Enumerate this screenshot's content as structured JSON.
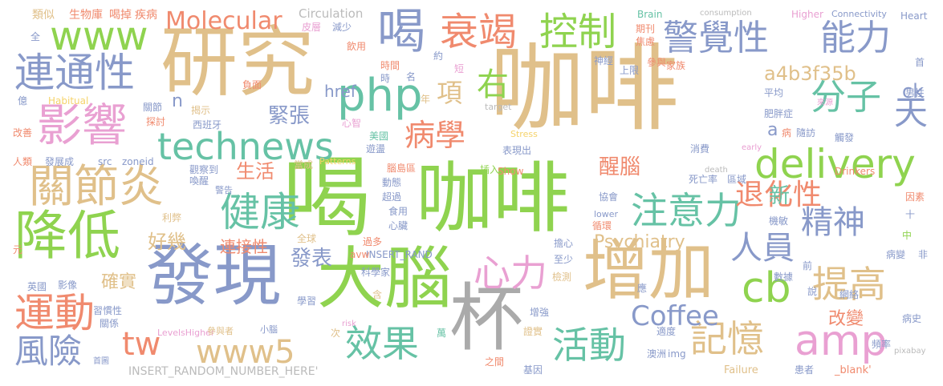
{
  "words": [
    {
      "text": "咖啡",
      "color": "#e0c08a"
    },
    {
      "text": "喝",
      "color": "#8fd34f"
    },
    {
      "text": "咖啡",
      "color": "#8fd34f"
    },
    {
      "text": "研究",
      "color": "#e0c08a"
    },
    {
      "text": "杯",
      "color": "#aaaaaa"
    },
    {
      "text": "發現",
      "color": "#8899c9"
    },
    {
      "text": "大腦",
      "color": "#8fd34f"
    },
    {
      "text": "增加",
      "color": "#e0c08a"
    },
    {
      "text": "降低",
      "color": "#8fd34f"
    },
    {
      "text": "影響",
      "color": "#e9a0d2"
    },
    {
      "text": "關節炎",
      "color": "#e0c08a"
    },
    {
      "text": "連通性",
      "color": "#8899c9"
    },
    {
      "text": "運動",
      "color": "#f08a6e"
    },
    {
      "text": "風險",
      "color": "#8899c9"
    },
    {
      "text": "喝",
      "color": "#8899c9"
    },
    {
      "text": "衰竭",
      "color": "#f08a6e"
    },
    {
      "text": "控制",
      "color": "#8fd34f"
    },
    {
      "text": "警覺性",
      "color": "#8899c9"
    },
    {
      "text": "能力",
      "color": "#8899c9"
    },
    {
      "text": "www",
      "color": "#8fd34f"
    },
    {
      "text": "php",
      "color": "#66c2a5"
    },
    {
      "text": "technews",
      "color": "#66c2a5"
    },
    {
      "text": "delivery",
      "color": "#8fd34f"
    },
    {
      "text": "健康",
      "color": "#66c2a5"
    },
    {
      "text": "注意力",
      "color": "#66c2a5"
    },
    {
      "text": "提高",
      "color": "#e0c08a"
    },
    {
      "text": "cb",
      "color": "#8fd34f"
    },
    {
      "text": "amp",
      "color": "#e9a0d2"
    },
    {
      "text": "心力",
      "color": "#e9a0d2"
    },
    {
      "text": "效果",
      "color": "#66c2a5"
    },
    {
      "text": "活動",
      "color": "#66c2a5"
    },
    {
      "text": "記憶",
      "color": "#e0c08a"
    },
    {
      "text": "www5",
      "color": "#e0c08a"
    },
    {
      "text": "tw",
      "color": "#f08a6e"
    },
    {
      "text": "Coffee",
      "color": "#8899c9"
    },
    {
      "text": "病學",
      "color": "#f08a6e"
    },
    {
      "text": "分子",
      "color": "#66c2a5"
    },
    {
      "text": "天",
      "color": "#8899c9"
    },
    {
      "text": "精神",
      "color": "#8899c9"
    },
    {
      "text": "人員",
      "color": "#8899c9"
    },
    {
      "text": "退化性",
      "color": "#f08a6e"
    },
    {
      "text": "右",
      "color": "#8fd34f"
    },
    {
      "text": "項",
      "color": "#e0c08a"
    },
    {
      "text": "Molecular",
      "color": "#f08a6e"
    },
    {
      "text": "緊張",
      "color": "#8899c9"
    },
    {
      "text": "a4b3f35b",
      "color": "#e0c08a"
    },
    {
      "text": "ck",
      "color": "#8899c9"
    },
    {
      "text": "href",
      "color": "#8899c9"
    },
    {
      "text": "醒腦",
      "color": "#f08a6e"
    },
    {
      "text": "生活",
      "color": "#f08a6e"
    },
    {
      "text": "好幾",
      "color": "#e0c08a"
    },
    {
      "text": "新",
      "color": "#66c2a5"
    },
    {
      "text": "Psychiatry",
      "color": "#e0c08a"
    },
    {
      "text": "連接性",
      "color": "#f08a6e"
    },
    {
      "text": "發表",
      "color": "#8899c9"
    },
    {
      "text": "確實",
      "color": "#e0c08a"
    },
    {
      "text": "改變",
      "color": "#f08a6e"
    },
    {
      "text": "n",
      "color": "#8899c9"
    },
    {
      "text": "a",
      "color": "#8899c9"
    },
    {
      "text": "Circulation",
      "color": "#bbbbbb"
    },
    {
      "text": "類似",
      "color": "#e0c08a"
    },
    {
      "text": "生物庫",
      "color": "#f08a6e"
    },
    {
      "text": "喝掉",
      "color": "#f08a6e"
    },
    {
      "text": "疾病",
      "color": "#f08a6e"
    },
    {
      "text": "INSERT_RANDOM_NUMBER_HERE'",
      "color": "#bbbbbb"
    },
    {
      "text": "INSERT_RAND",
      "color": "#8899c9"
    },
    {
      "text": "zoneid",
      "color": "#8899c9"
    },
    {
      "text": "src",
      "color": "#8899c9"
    },
    {
      "text": "Brain",
      "color": "#66c2a5"
    },
    {
      "text": "consumption",
      "color": "#bbbbbb"
    },
    {
      "text": "Higher",
      "color": "#e9a0d2"
    },
    {
      "text": "Connectivity",
      "color": "#8899c9"
    },
    {
      "text": "Heart",
      "color": "#8899c9"
    },
    {
      "text": "Habitual",
      "color": "#f5d36b"
    },
    {
      "text": "Patterns",
      "color": "#f5d36b"
    },
    {
      "text": "Stress",
      "color": "#f5d36b"
    },
    {
      "text": "Show",
      "color": "#f08a6e"
    },
    {
      "text": "target",
      "color": "#bbbbbb"
    },
    {
      "text": "lower",
      "color": "#8899c9"
    },
    {
      "text": "Drinkers",
      "color": "#f08a6e"
    },
    {
      "text": "Failure",
      "color": "#e0c08a"
    },
    {
      "text": "_blank'",
      "color": "#f08a6e"
    },
    {
      "text": "img",
      "color": "#8899c9"
    },
    {
      "text": "pixabay",
      "color": "#bbbbbb"
    },
    {
      "text": "LevelsHigher",
      "color": "#e9a0d2"
    },
    {
      "text": "risk",
      "color": "#e9a0d2"
    },
    {
      "text": "death",
      "color": "#bbbbbb"
    },
    {
      "text": "early",
      "color": "#e9a0d2"
    },
    {
      "text": "avw",
      "color": "#f08a6e"
    },
    {
      "text": "皮層",
      "color": "#e9a0d2"
    },
    {
      "text": "減少",
      "color": "#8899c9"
    },
    {
      "text": "飲用",
      "color": "#f08a6e"
    },
    {
      "text": "時間",
      "color": "#f08a6e"
    },
    {
      "text": "約",
      "color": "#8899c9"
    },
    {
      "text": "短",
      "color": "#e9a0d2"
    },
    {
      "text": "名",
      "color": "#8899c9"
    },
    {
      "text": "時",
      "color": "#8899c9"
    },
    {
      "text": "年",
      "color": "#e0c08a"
    },
    {
      "text": "心智",
      "color": "#e9a0d2"
    },
    {
      "text": "負面",
      "color": "#f08a6e"
    },
    {
      "text": "關節",
      "color": "#8899c9"
    },
    {
      "text": "揭示",
      "color": "#e0c08a"
    },
    {
      "text": "探討",
      "color": "#f08a6e"
    },
    {
      "text": "西班牙",
      "color": "#8899c9"
    },
    {
      "text": "美國",
      "color": "#66c2a5"
    },
    {
      "text": "遊盪",
      "color": "#8899c9"
    },
    {
      "text": "表現出",
      "color": "#8899c9"
    },
    {
      "text": "腦島區",
      "color": "#f08a6e"
    },
    {
      "text": "插入",
      "color": "#8fd34f"
    },
    {
      "text": "觀察到",
      "color": "#8899c9"
    },
    {
      "text": "當成",
      "color": "#e0c08a"
    },
    {
      "text": "喚醒",
      "color": "#8899c9"
    },
    {
      "text": "警告",
      "color": "#8899c9"
    },
    {
      "text": "動態",
      "color": "#8899c9"
    },
    {
      "text": "超過",
      "color": "#8899c9"
    },
    {
      "text": "食用",
      "color": "#8899c9"
    },
    {
      "text": "心臟",
      "color": "#8899c9"
    },
    {
      "text": "全球",
      "color": "#e0c08a"
    },
    {
      "text": "利弊",
      "color": "#e0c08a"
    },
    {
      "text": "過多",
      "color": "#f08a6e"
    },
    {
      "text": "科學家",
      "color": "#8899c9"
    },
    {
      "text": "學習",
      "color": "#8899c9"
    },
    {
      "text": "含",
      "color": "#e0c08a"
    },
    {
      "text": "影像",
      "color": "#8899c9"
    },
    {
      "text": "英國",
      "color": "#8899c9"
    },
    {
      "text": "習慣性",
      "color": "#8899c9"
    },
    {
      "text": "關係",
      "color": "#8899c9"
    },
    {
      "text": "參與者",
      "color": "#e0c08a"
    },
    {
      "text": "小腦",
      "color": "#8899c9"
    },
    {
      "text": "次",
      "color": "#e0c08a"
    },
    {
      "text": "萬",
      "color": "#66c2a5"
    },
    {
      "text": "之間",
      "color": "#f08a6e"
    },
    {
      "text": "基因",
      "color": "#8899c9"
    },
    {
      "text": "證實",
      "color": "#e0c08a"
    },
    {
      "text": "增強",
      "color": "#8899c9"
    },
    {
      "text": "檢測",
      "color": "#e0c08a"
    },
    {
      "text": "擔心",
      "color": "#8899c9"
    },
    {
      "text": "至少",
      "color": "#8899c9"
    },
    {
      "text": "循環",
      "color": "#f08a6e"
    },
    {
      "text": "協會",
      "color": "#8899c9"
    },
    {
      "text": "死亡率",
      "color": "#8899c9"
    },
    {
      "text": "區域",
      "color": "#8899c9"
    },
    {
      "text": "消費",
      "color": "#8899c9"
    },
    {
      "text": "機敏",
      "color": "#8899c9"
    },
    {
      "text": "期刊",
      "color": "#f08a6e"
    },
    {
      "text": "焦慮",
      "color": "#f08a6e"
    },
    {
      "text": "上限",
      "color": "#8899c9"
    },
    {
      "text": "神經",
      "color": "#8899c9"
    },
    {
      "text": "參與",
      "color": "#f08a6e"
    },
    {
      "text": "家族",
      "color": "#f08a6e"
    },
    {
      "text": "平均",
      "color": "#8899c9"
    },
    {
      "text": "肥胖症",
      "color": "#8899c9"
    },
    {
      "text": "病",
      "color": "#f08a6e"
    },
    {
      "text": "隨訪",
      "color": "#8899c9"
    },
    {
      "text": "觸發",
      "color": "#8899c9"
    },
    {
      "text": "來源",
      "color": "#e9a0d2"
    },
    {
      "text": "首",
      "color": "#8899c9"
    },
    {
      "text": "男性",
      "color": "#8899c9"
    },
    {
      "text": "因素",
      "color": "#f08a6e"
    },
    {
      "text": "十",
      "color": "#8899c9"
    },
    {
      "text": "中",
      "color": "#8fd34f"
    },
    {
      "text": "非",
      "color": "#8899c9"
    },
    {
      "text": "病變",
      "color": "#8899c9"
    },
    {
      "text": "前",
      "color": "#8899c9"
    },
    {
      "text": "數據",
      "color": "#8899c9"
    },
    {
      "text": "說",
      "color": "#8899c9"
    },
    {
      "text": "應",
      "color": "#8899c9"
    },
    {
      "text": "網絡",
      "color": "#8899c9"
    },
    {
      "text": "病史",
      "color": "#8899c9"
    },
    {
      "text": "適度",
      "color": "#8899c9"
    },
    {
      "text": "頻率",
      "color": "#8899c9"
    },
    {
      "text": "澳洲",
      "color": "#8899c9"
    },
    {
      "text": "患者",
      "color": "#8899c9"
    },
    {
      "text": "首圖",
      "color": "#8899c9"
    },
    {
      "text": "億",
      "color": "#8899c9"
    },
    {
      "text": "改善",
      "color": "#f08a6e"
    },
    {
      "text": "人類",
      "color": "#f08a6e"
    },
    {
      "text": "發展成",
      "color": "#8899c9"
    },
    {
      "text": "元",
      "color": "#f08a6e"
    },
    {
      "text": "全",
      "color": "#8899c9"
    }
  ]
}
